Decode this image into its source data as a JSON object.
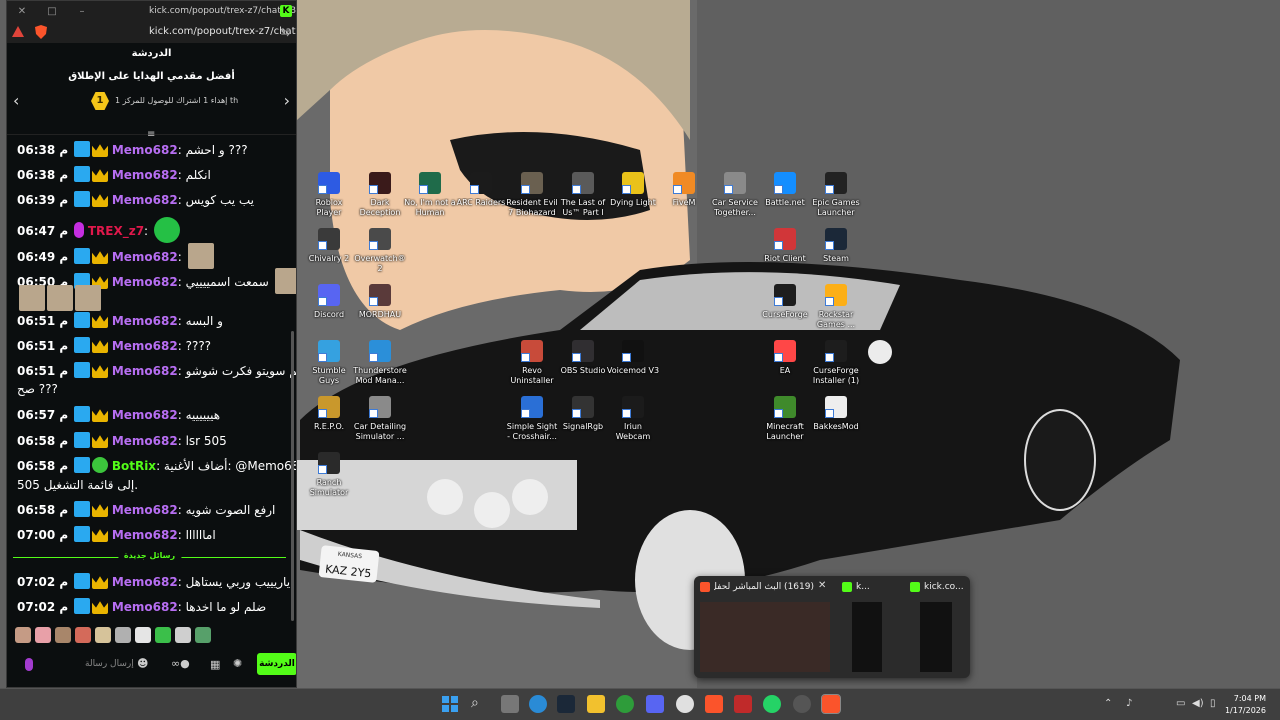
{
  "browser": {
    "window_title": "kick.com/popout/trex-z7/chat - Brave",
    "url": "kick.com/popout/trex-z7/chat",
    "kick_badge": "K"
  },
  "chat": {
    "header": "الدردشة",
    "gifters_title": "أفضل مقدمي الهدايا على الإطلاق",
    "gifter_rank": "1",
    "gifter_text": "إهداء 1 اشتراك للوصول للمركز 1 th",
    "new_messages_label": "رسائل جديدة",
    "input_placeholder": "إرسال رسالة",
    "send_label": "الدردشة",
    "messages": [
      {
        "time": "06:38 م",
        "user": "Memo682",
        "text": "و احشم ???"
      },
      {
        "time": "06:38 م",
        "user": "Memo682",
        "text": "انكلم"
      },
      {
        "time": "06:39 م",
        "user": "Memo682",
        "text": "يب يب كويس"
      },
      {
        "time": "06:47 م",
        "user": "TREX_z7",
        "text": ""
      },
      {
        "time": "06:49 م",
        "user": "Memo682",
        "text": ""
      },
      {
        "time": "06:50 م",
        "user": "Memo682",
        "text": "سمعت اسمييييي"
      },
      {
        "time": "06:51 م",
        "user": "Memo682",
        "text": "و البسه"
      },
      {
        "time": "06:51 م",
        "user": "Memo682",
        "text": "????"
      },
      {
        "time": "06:51 م",
        "user": "Memo682",
        "text": "شكلكم سويتو فكرت شوشو",
        "text2": "صح ???"
      },
      {
        "time": "06:57 م",
        "user": "Memo682",
        "text": "هييييييه"
      },
      {
        "time": "06:58 م",
        "user": "Memo682",
        "text": "lsr 505"
      },
      {
        "time": "06:58 م",
        "user": "BotRix",
        "text": "أضاف الأغنية: @Memo682",
        "text2": "505 إلى قائمة التشغيل."
      },
      {
        "time": "06:58 م",
        "user": "Memo682",
        "text": "ارفع الصوت شويه"
      },
      {
        "time": "07:00 م",
        "user": "Memo682",
        "text": "اماااااا"
      },
      {
        "time": "07:02 م",
        "user": "Memo682",
        "text": "ياريييب وربي يستاهل"
      },
      {
        "time": "07:02 م",
        "user": "Memo682",
        "text": "ضلم لو ما اخدها"
      }
    ]
  },
  "desktop_icons": [
    {
      "label": "Roblox Player",
      "color": "#2d5be3"
    },
    {
      "label": "Dark Deception",
      "color": "#3a1a1a"
    },
    {
      "label": "No, I'm not a Human",
      "color": "#1f6b4a"
    },
    {
      "label": "ARC Raiders",
      "color": "#1b1b1b"
    },
    {
      "label": "Resident Evil 7 Biohazard",
      "color": "#6a6050"
    },
    {
      "label": "The Last of Us™ Part I",
      "color": "#5a5a5a"
    },
    {
      "label": "Dying Light",
      "color": "#e9c21a"
    },
    {
      "label": "FiveM",
      "color": "#f08a24"
    },
    {
      "label": "Car Service Together...",
      "color": "#8a8a8a"
    },
    {
      "label": "Battle.net",
      "color": "#148eff"
    },
    {
      "label": "Epic Games Launcher",
      "color": "#222222"
    },
    {
      "label": "Chivalry 2",
      "color": "#3a3a3a"
    },
    {
      "label": "Overwatch® 2",
      "color": "#4a4a4a"
    },
    {
      "label": "Riot Client",
      "color": "#d13639"
    },
    {
      "label": "Steam",
      "color": "#1b2838"
    },
    {
      "label": "Discord",
      "color": "#5865f2"
    },
    {
      "label": "MORDHAU",
      "color": "#5a3a3a"
    },
    {
      "label": "CurseForge",
      "color": "#1d1d1d"
    },
    {
      "label": "Rockstar Games ...",
      "color": "#fcaf17"
    },
    {
      "label": "Stumble Guys",
      "color": "#35a1e0"
    },
    {
      "label": "Thunderstore Mod Mana...",
      "color": "#2b8fd9"
    },
    {
      "label": "Revo Uninstaller",
      "color": "#c84b3a"
    },
    {
      "label": "OBS Studio",
      "color": "#302e31"
    },
    {
      "label": "Voicemod V3",
      "color": "#111111"
    },
    {
      "label": "EA",
      "color": "#ff4747"
    },
    {
      "label": "CurseForge Installer (1)",
      "color": "#1d1d1d"
    },
    {
      "label": "R.E.P.O.",
      "color": "#c9982c"
    },
    {
      "label": "Car Detailing Simulator ...",
      "color": "#8a8a8a"
    },
    {
      "label": "Simple Sight - Crosshair...",
      "color": "#2a6fd6"
    },
    {
      "label": "SignalRgb",
      "color": "#333333"
    },
    {
      "label": "Iriun Webcam",
      "color": "#1b1b1b"
    },
    {
      "label": "Minecraft Launcher",
      "color": "#3f8a2b"
    },
    {
      "label": "BakkesMod",
      "color": "#eeeeee"
    },
    {
      "label": "Ranch Simulator",
      "color": "#2a2a2a"
    }
  ],
  "thumbnails": [
    {
      "title": "(1619) البث المباشر لحفل جو...",
      "icon": "brave"
    },
    {
      "title": "k...",
      "icon": "kick"
    },
    {
      "title": "kick.co...",
      "icon": "kick"
    }
  ],
  "plate_text": "KAZ 2Y5",
  "plate_top": "KANSAS",
  "clock": {
    "time": "7:04 PM",
    "date": "1/17/2026"
  }
}
